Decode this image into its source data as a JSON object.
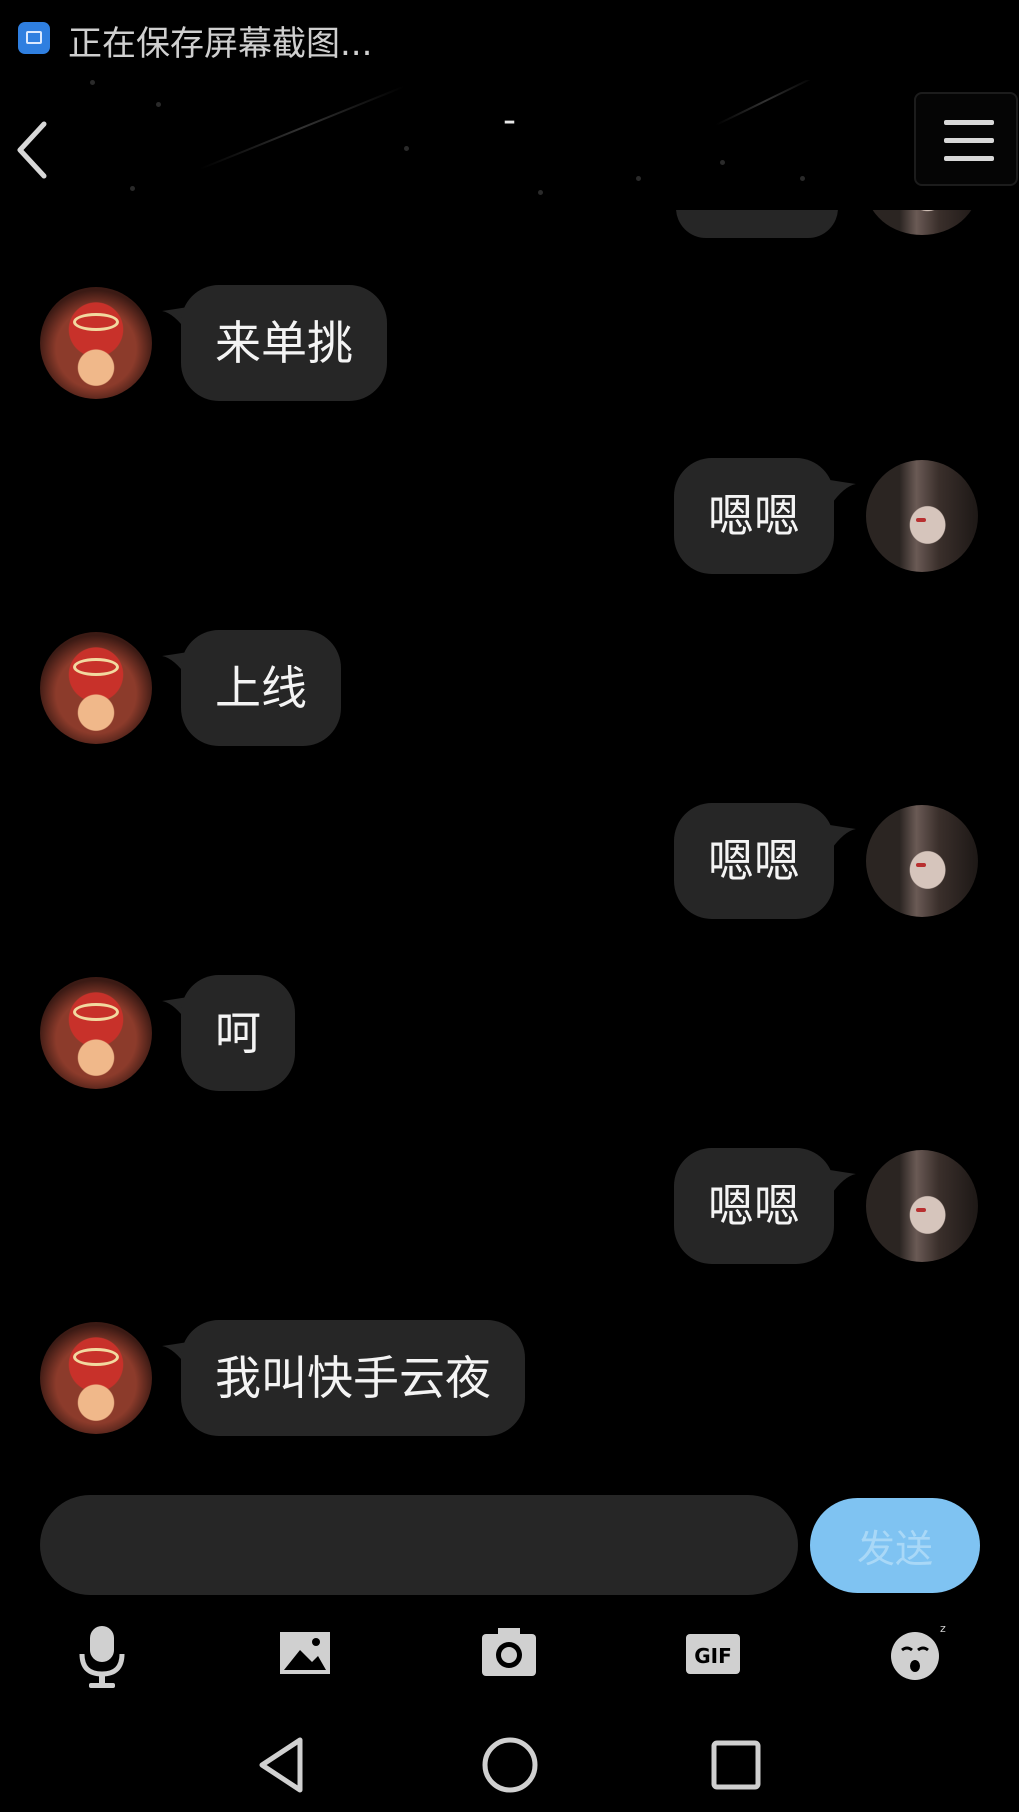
{
  "status_bar": {
    "text": "正在保存屏幕截图..."
  },
  "header": {
    "title": "-"
  },
  "messages": [
    {
      "side": "left",
      "text": "来单挑"
    },
    {
      "side": "right",
      "text": "嗯嗯"
    },
    {
      "side": "left",
      "text": "上线"
    },
    {
      "side": "right",
      "text": "嗯嗯"
    },
    {
      "side": "left",
      "text": "呵"
    },
    {
      "side": "right",
      "text": "嗯嗯"
    },
    {
      "side": "left",
      "text": "我叫快手云夜"
    }
  ],
  "input": {
    "value": "",
    "placeholder": ""
  },
  "send_button": {
    "label": "发送"
  },
  "toolbar": {
    "items": [
      "microphone-icon",
      "image-icon",
      "camera-icon",
      "gif-icon",
      "emoji-icon"
    ],
    "gif_label": "GIF"
  },
  "colors": {
    "background": "#000000",
    "bubble": "#262626",
    "send_button": "#7fc3f2",
    "icon": "#d0d0d0"
  }
}
